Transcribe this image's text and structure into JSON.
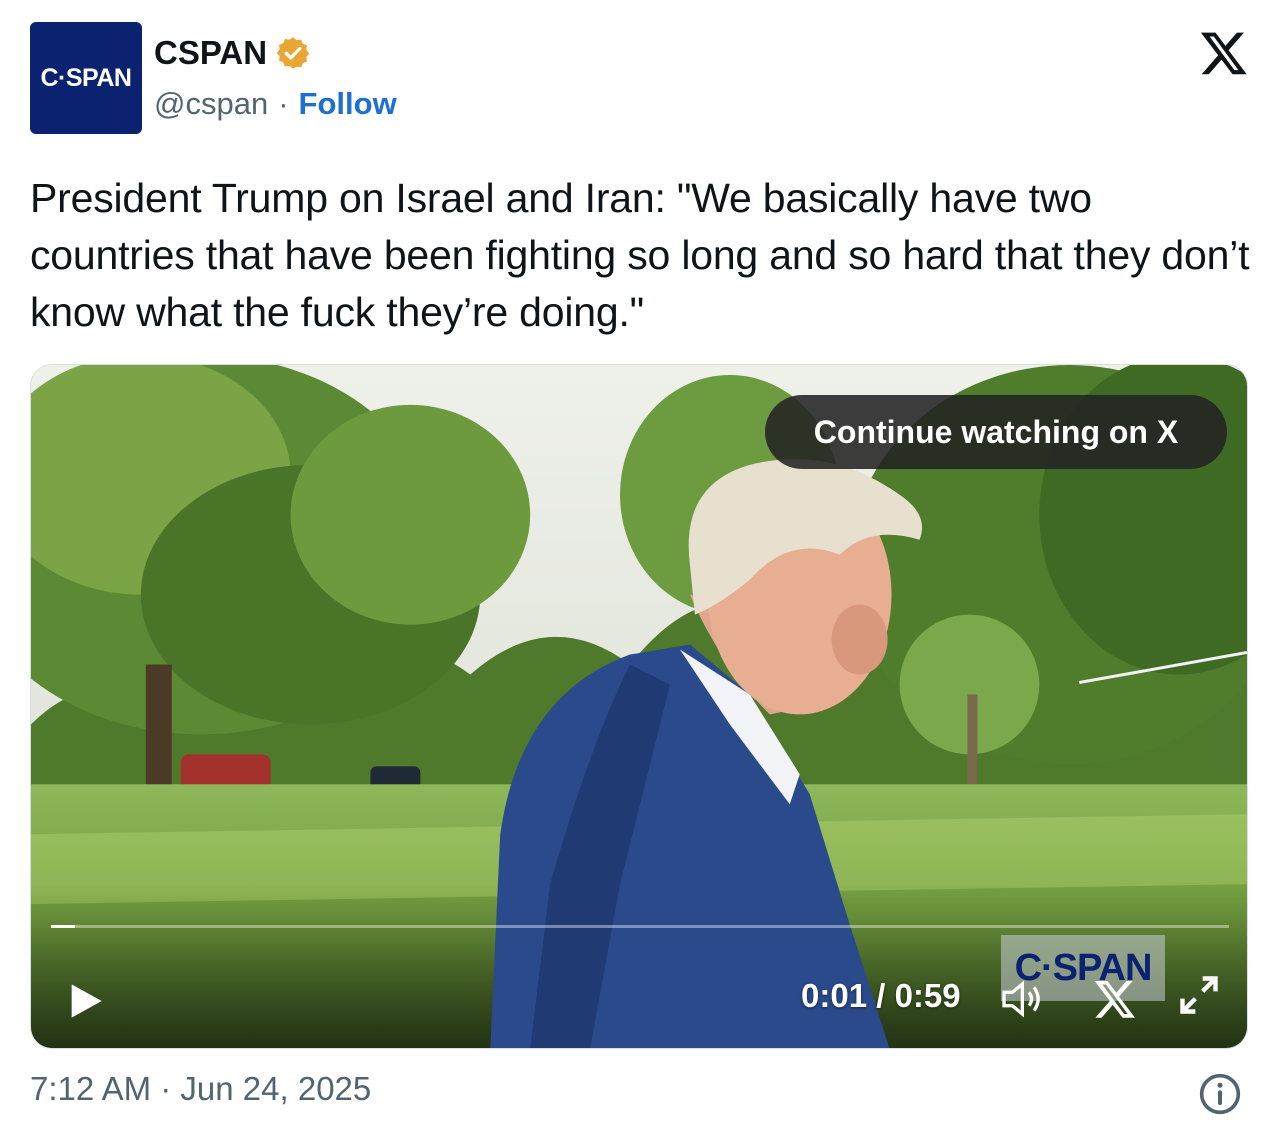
{
  "header": {
    "avatar_text": "C·SPAN",
    "name": "CSPAN",
    "handle": "@cspan",
    "separator": "·",
    "follow_label": "Follow",
    "badge_color": "#e8a735",
    "brand_color": "#0b2270"
  },
  "tweet": {
    "text": "President Trump on Israel and Iran: \"We basically have two countries that have been fighting so long and so hard that they don’t know what the fuck they’re doing.\""
  },
  "video": {
    "continue_label": "Continue watching on X",
    "elapsed": "0:01",
    "time_sep": " / ",
    "duration": "0:59",
    "watermark_text": "C·SPAN",
    "progress_fraction": 0.02
  },
  "footer": {
    "time": "7:12 AM",
    "separator": "·",
    "date": "Jun 24, 2025"
  }
}
